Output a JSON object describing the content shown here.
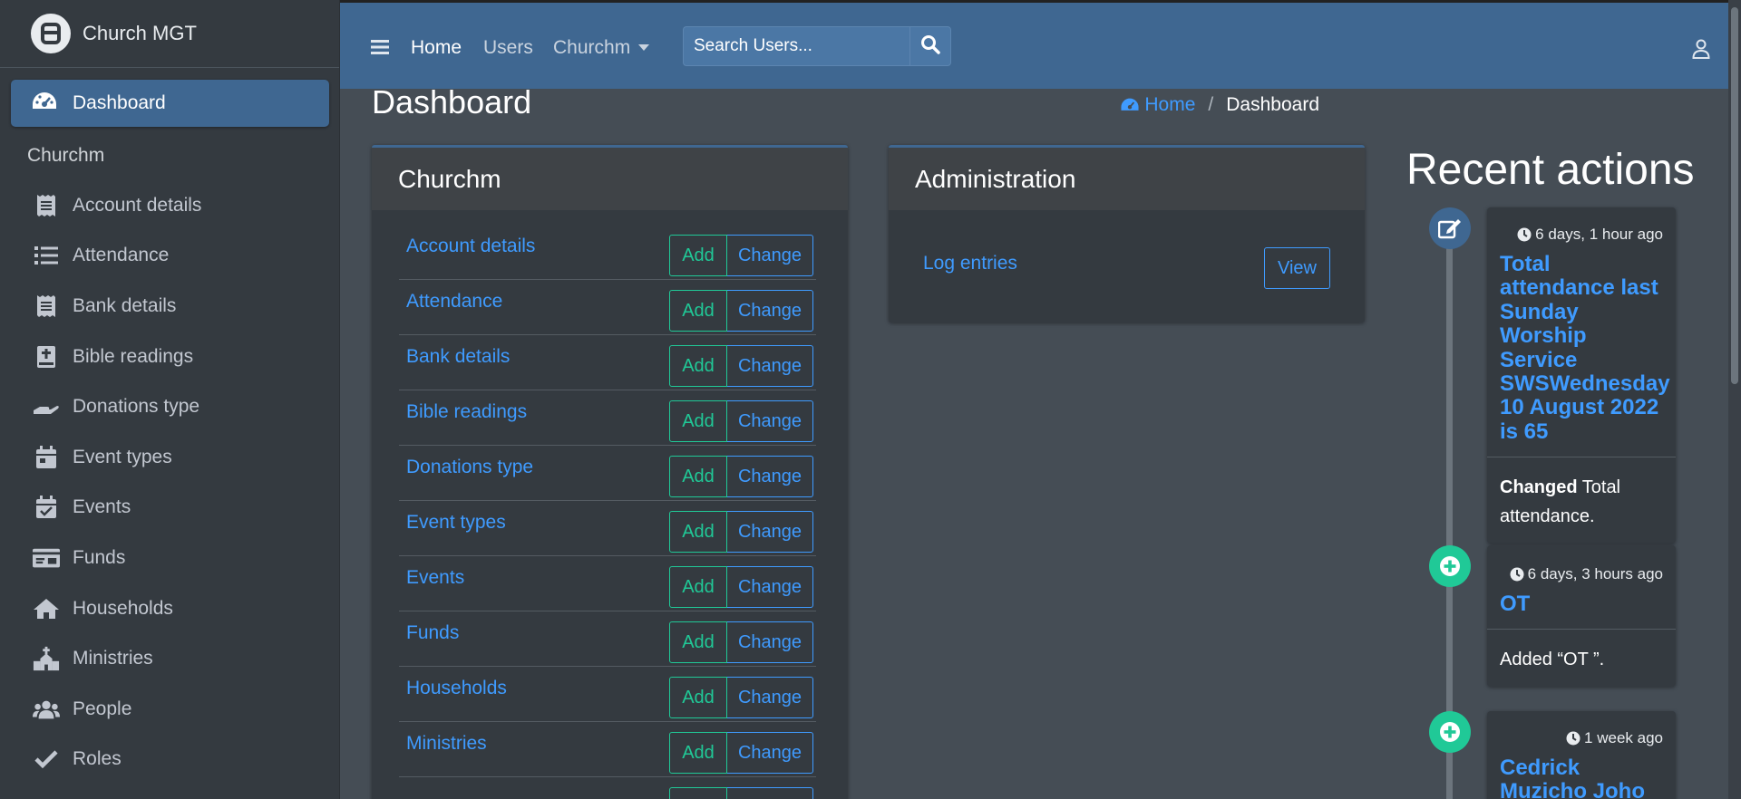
{
  "brand": {
    "name": "Church MGT"
  },
  "sidebar": {
    "active": {
      "label": "Dashboard"
    },
    "section": "Churchm",
    "items": [
      {
        "label": "Account details",
        "icon": "receipt-icon"
      },
      {
        "label": "Attendance",
        "icon": "list-icon"
      },
      {
        "label": "Bank details",
        "icon": "receipt-icon"
      },
      {
        "label": "Bible readings",
        "icon": "bible-icon"
      },
      {
        "label": "Donations type",
        "icon": "hand-holding-icon"
      },
      {
        "label": "Event types",
        "icon": "calendar-icon"
      },
      {
        "label": "Events",
        "icon": "calendar-check-icon"
      },
      {
        "label": "Funds",
        "icon": "money-check-icon"
      },
      {
        "label": "Households",
        "icon": "home-icon"
      },
      {
        "label": "Ministries",
        "icon": "church-icon"
      },
      {
        "label": "People",
        "icon": "users-icon"
      },
      {
        "label": "Roles",
        "icon": "check-icon"
      }
    ]
  },
  "topbar": {
    "home": "Home",
    "users": "Users",
    "churchm": "Churchm",
    "search_placeholder": "Search Users..."
  },
  "page": {
    "title": "Dashboard",
    "breadcrumb": {
      "home": "Home",
      "current": "Dashboard"
    }
  },
  "churchm_card": {
    "title": "Churchm",
    "add_label": "Add",
    "change_label": "Change",
    "models": [
      "Account details",
      "Attendance",
      "Bank details",
      "Bible readings",
      "Donations type",
      "Event types",
      "Events",
      "Funds",
      "Households",
      "Ministries"
    ]
  },
  "admin_card": {
    "title": "Administration",
    "log_entries": "Log entries",
    "view_label": "View"
  },
  "recent": {
    "title": "Recent actions",
    "items": [
      {
        "type": "edit",
        "time": "6 days, 1 hour ago",
        "heading": "Total attendance last Sunday Worship Service SWSWednesday 10 August 2022 is 65",
        "body_strong": "Changed",
        "body": " Total attendance."
      },
      {
        "type": "add",
        "time": "6 days, 3 hours ago",
        "heading": "OT",
        "body": "Added “OT ”."
      },
      {
        "type": "add",
        "time": "1 week ago",
        "heading": "Cedrick Muzicho Joho"
      }
    ]
  },
  "colors": {
    "accent": "#3f6791",
    "link": "#3f9bff",
    "success": "#20c997",
    "sidebar": "#343a40",
    "content": "#454d55"
  }
}
